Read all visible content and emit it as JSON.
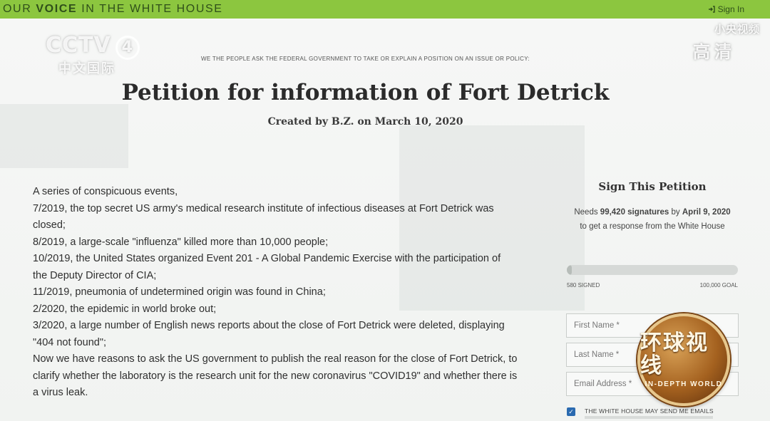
{
  "topbar": {
    "title_prefix": "OUR ",
    "title_bold": "VOICE",
    "title_suffix": " IN THE WHITE HOUSE",
    "signin_label": "Sign In",
    "signin_icon": "sign-in-icon",
    "color": "#8cc63f"
  },
  "overlays": {
    "channel_logo": "CCTV",
    "channel_number": "4",
    "channel_sub": "中文国际",
    "right_line1": "小央视频",
    "right_line2": "高清"
  },
  "petition": {
    "kicker": "WE THE PEOPLE ASK THE FEDERAL GOVERNMENT TO TAKE OR EXPLAIN A POSITION ON AN ISSUE OR POLICY:",
    "title": "Petition for information of Fort Detrick",
    "byline": "Created by B.Z. on March 10, 2020",
    "body": [
      "A series of conspicuous events,",
      "7/2019, the top secret US army's medical research institute of infectious diseases at Fort Detrick was closed;",
      "8/2019, a large-scale \"influenza\" killed more than 10,000 people;",
      "10/2019, the United States organized Event 201 - A Global Pandemic Exercise with the participation of the Deputy Director of CIA;",
      "11/2019, pneumonia of undetermined origin was found in China;",
      "2/2020, the epidemic in world broke out;",
      "3/2020, a large number of English news reports about the close of Fort Detrick were deleted, displaying \"404 not found\";",
      "Now we have reasons to ask the US government to publish the real reason for the close of Fort Detrick, to clarify whether the laboratory is the research unit for the new coronavirus \"COVID19\" and whether there is a virus leak."
    ]
  },
  "sign_panel": {
    "title": "Sign This Petition",
    "desc_pre": "Needs ",
    "desc_count": "99,420 signatures",
    "desc_mid": " by ",
    "desc_date": "April 9, 2020",
    "desc_post": " to get a response from the White House",
    "signed_label": "580 SIGNED",
    "goal_label": "100,000 GOAL",
    "progress_fraction": 0.0058,
    "first_name_placeholder": "First Name *",
    "last_name_placeholder": "Last Name *",
    "email_placeholder": "Email Address *",
    "checkbox_label": "THE WHITE HOUSE MAY SEND ME EMAILS",
    "checkbox_checked": true
  },
  "badge": {
    "zh": "环球视线",
    "en": "IN-DEPTH WORLD"
  }
}
